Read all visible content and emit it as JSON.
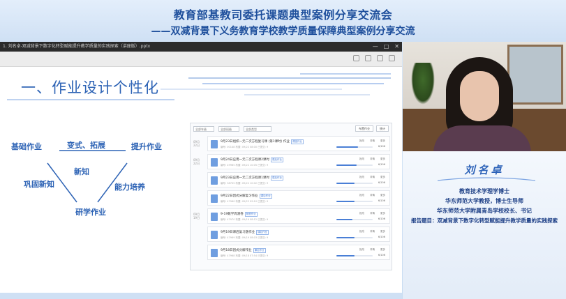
{
  "banner": {
    "title": "教育部基教司委托课题典型案例分享交流会",
    "subtitle": "——双减背景下义务教育学校教学质量保障典型案例分享交流"
  },
  "presentation": {
    "window_title": "1. 刘名卓-双减背景下数字化转型赋能提升教学质量的实践探索（讲座版）.pptx",
    "slide": {
      "heading": "一、作业设计个性化",
      "diagram": {
        "top_left": "基础作业",
        "top_mid": "变式、拓展",
        "top_right": "提升作业",
        "mid": "新知",
        "left": "巩固新知",
        "right": "能力培养",
        "bottom": "研学作业"
      }
    },
    "embedded": {
      "filters": [
        "全部年级",
        "全部班级",
        "全部类型"
      ],
      "actions": [
        "布置作业",
        "统计"
      ],
      "rows": [
        {
          "date": "09月\n22日",
          "title": "9月23日组织一元二次方程复习课 (第1课时) 作业",
          "tag": "课堂作业",
          "meta": "编号: 00148  布置: 09/22 08:00  已提交: 9",
          "ops": [
            "批改",
            "详情",
            "更多"
          ],
          "pct": "6/106",
          "progress": 0.6
        },
        {
          "date": "09月\n22日",
          "title": "9月24日应用一元二次方程课2课时",
          "tag": "课后作业",
          "meta": "编号: 49965  布置: 09/22 10:05  已提交: 9",
          "ops": [
            "批改",
            "详情",
            "更多"
          ],
          "pct": "6/106",
          "progress": 0.55
        },
        {
          "date": "",
          "title": "9月23日应用一元二次方程课1课时",
          "tag": "课后作业",
          "meta": "编号: 38705  布置: 09/22 10:02  已提交: 9",
          "ops": [
            "批改",
            "详情",
            "更多"
          ],
          "pct": "6/106",
          "progress": 0.5
        },
        {
          "date": "",
          "title": "9月22日因式分解复习作业",
          "tag": "课后作业",
          "meta": "编号: 47960  布置: 09/22 09:10  已提交: 9",
          "ops": [
            "批改",
            "详情",
            "更多"
          ],
          "pct": "6/106",
          "progress": 0.5
        },
        {
          "date": "09月\n19日",
          "title": "9-19数学周测卷",
          "tag": "随堂作业",
          "meta": "编号: 47970  布置: 09/19 08:12  已提交: 9",
          "ops": [
            "批改",
            "详情",
            "更多"
          ],
          "pct": "6/106",
          "progress": 0.45
        },
        {
          "date": "",
          "title": "9月19日课后复习题作业",
          "tag": "课后作业",
          "meta": "编号: 47969  布置: 09/19 08:03  已提交: 9",
          "ops": [
            "批改",
            "详情",
            "更多"
          ],
          "pct": "6/106",
          "progress": 0.5
        },
        {
          "date": "",
          "title": "9月18日因式分解作业",
          "tag": "课后作业",
          "meta": "编号: 47968  布置: 09/18 07:54  已提交: 9",
          "ops": [
            "批改",
            "详情",
            "更多"
          ],
          "pct": "6/106",
          "progress": 0.5
        }
      ]
    }
  },
  "speaker_card": {
    "name": "刘名卓",
    "line1": "教育技术学理学博士",
    "line2": "华东师范大学教授，博士生导师",
    "line3": "华东师范大学附属青岛学校校长、书记",
    "line4": "报告题目：双减背景下数字化转型赋能提升教学质量的实践探索"
  },
  "colors": {
    "banner_text": "#1e4f9c",
    "slide_heading": "#2d63b5",
    "name": "#2c62b8"
  }
}
